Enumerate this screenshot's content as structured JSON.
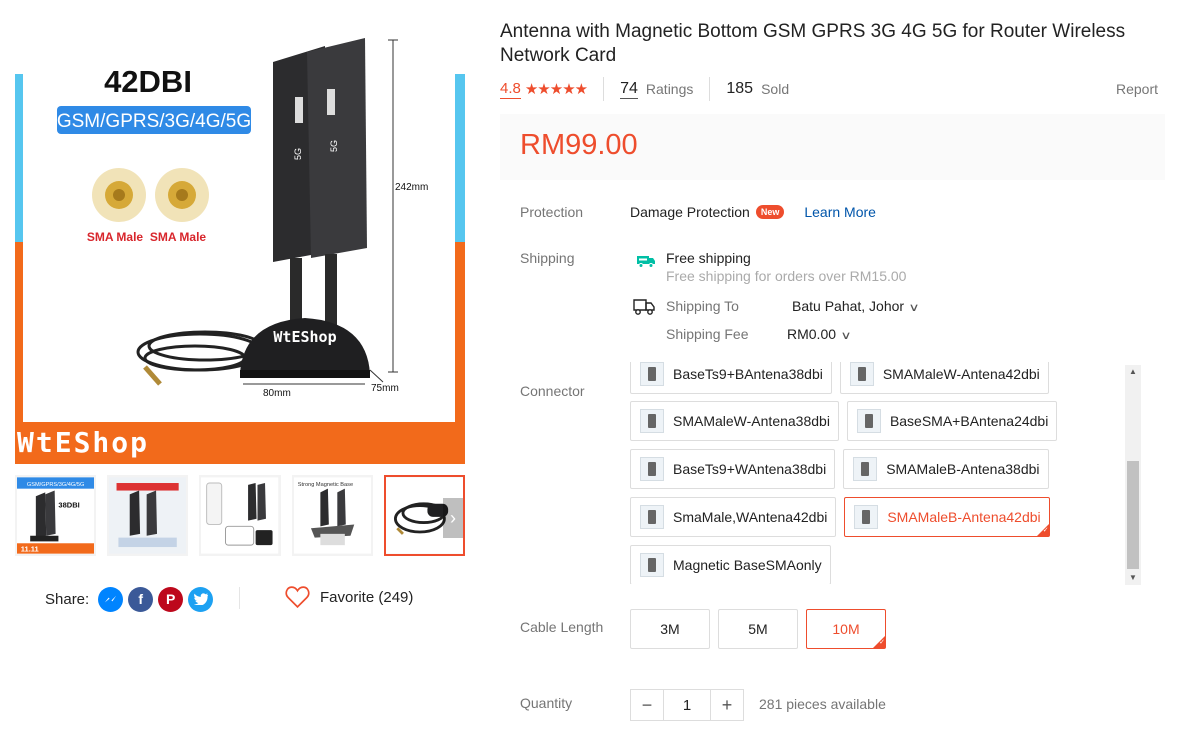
{
  "gallery": {
    "main_image": {
      "headline": "42DBI",
      "band_label": "GSM/GPRS/3G/4G/5G",
      "connector_labels": [
        "SMA Male",
        "SMA Male"
      ],
      "dimension_height": "242mm",
      "dimension_width": "80mm",
      "dimension_depth": "75mm",
      "base_brand": "WtEShop",
      "antenna_marks": [
        "5G",
        "5G"
      ],
      "watermark": "WtEShop"
    },
    "thumbnails": [
      {
        "name": "antenna-42dbi-overview",
        "active": false
      },
      {
        "name": "antenna-accessories",
        "active": false
      },
      {
        "name": "router-modem-set",
        "active": false
      },
      {
        "name": "magnetic-base-setup",
        "active": false
      },
      {
        "name": "cable-and-base",
        "active": true
      }
    ],
    "thumb_text_1": "GSM/GPRS/3G/4G/5G",
    "thumb_text_1b": "38DBI",
    "thumb_badge": "11.11",
    "thumb_text_4": "Strong Magnetic Base"
  },
  "share": {
    "label": "Share:",
    "icons": [
      {
        "name": "messenger-icon",
        "color": "#0084ff",
        "glyph": "m"
      },
      {
        "name": "facebook-icon",
        "color": "#3b5998",
        "glyph": "f"
      },
      {
        "name": "pinterest-icon",
        "color": "#bd081c",
        "glyph": "P"
      },
      {
        "name": "twitter-icon",
        "color": "#1da1f2",
        "glyph": "t"
      }
    ]
  },
  "favorite": {
    "label": "Favorite (249)"
  },
  "product": {
    "title": "Antenna with Magnetic Bottom GSM GPRS 3G 4G 5G for Router Wireless Network Card",
    "rating": "4.8",
    "stars": "★★★★★",
    "ratings_count": "74",
    "ratings_label": "Ratings",
    "sold_count": "185",
    "sold_label": "Sold",
    "report": "Report",
    "price": "RM99.00"
  },
  "protection": {
    "label": "Protection",
    "value": "Damage Protection",
    "badge": "New",
    "link": "Learn More"
  },
  "shipping": {
    "label": "Shipping",
    "free_title": "Free shipping",
    "free_sub": "Free shipping for orders over RM15.00",
    "to_label": "Shipping To",
    "to_value": "Batu Pahat, Johor",
    "fee_label": "Shipping Fee",
    "fee_value": "RM0.00"
  },
  "connector": {
    "label": "Connector",
    "options": [
      {
        "label": "BaseTs9+BAntena38dbi",
        "selected": false
      },
      {
        "label": "SMAMaleW-Antena42dbi",
        "selected": false
      },
      {
        "label": "SMAMaleW-Antena38dbi",
        "selected": false
      },
      {
        "label": "BaseSMA+BAntena24dbi",
        "selected": false
      },
      {
        "label": "BaseTs9+WAntena38dbi",
        "selected": false
      },
      {
        "label": "SMAMaleB-Antena38dbi",
        "selected": false
      },
      {
        "label": "SmaMale,WAntena42dbi",
        "selected": false
      },
      {
        "label": "SMAMaleB-Antena42dbi",
        "selected": true
      },
      {
        "label": "Magnetic BaseSMAonly",
        "selected": false
      }
    ]
  },
  "cable_length": {
    "label": "Cable Length",
    "options": [
      {
        "label": "3M",
        "selected": false
      },
      {
        "label": "5M",
        "selected": false
      },
      {
        "label": "10M",
        "selected": true
      }
    ]
  },
  "quantity": {
    "label": "Quantity",
    "minus": "−",
    "value": "1",
    "plus": "+",
    "available": "281 pieces available"
  },
  "colors": {
    "accent": "#ee4d2d",
    "link": "#0055aa"
  }
}
